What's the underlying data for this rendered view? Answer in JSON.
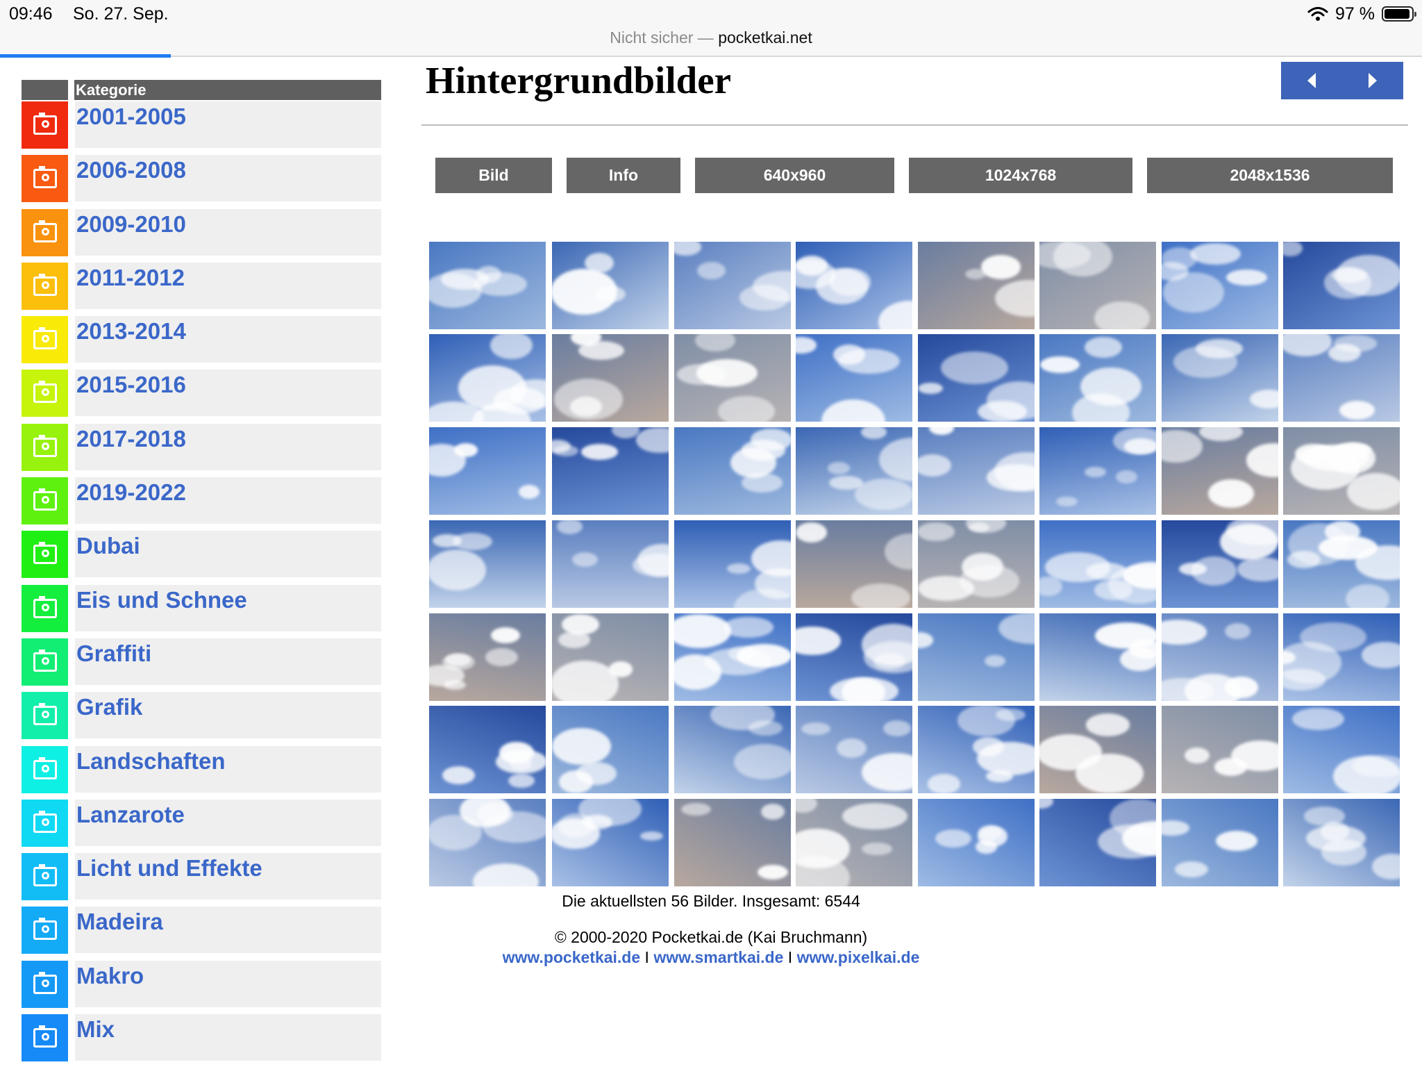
{
  "status_bar": {
    "time": "09:46",
    "date": "So. 27. Sep.",
    "battery": "97 %",
    "battery_level": 0.97
  },
  "url_bar": {
    "insecure_label": "Nicht sicher",
    "separator": " — ",
    "domain": "pocketkai.net",
    "load_progress": 0.12
  },
  "sidebar": {
    "header": "Kategorie",
    "items": [
      {
        "label": "2001-2005",
        "color": "#f02a0f"
      },
      {
        "label": "2006-2008",
        "color": "#f75a10"
      },
      {
        "label": "2009-2010",
        "color": "#f9920e"
      },
      {
        "label": "2011-2012",
        "color": "#fbbf0c"
      },
      {
        "label": "2013-2014",
        "color": "#f9ea07"
      },
      {
        "label": "2015-2016",
        "color": "#c6f40b"
      },
      {
        "label": "2017-2018",
        "color": "#97f30d"
      },
      {
        "label": "2019-2022",
        "color": "#5ef10f"
      },
      {
        "label": "Dubai",
        "color": "#20ef14"
      },
      {
        "label": "Eis und Schnee",
        "color": "#14ee3d"
      },
      {
        "label": "Graffiti",
        "color": "#12ee74"
      },
      {
        "label": "Grafik",
        "color": "#12efaa"
      },
      {
        "label": "Landschaften",
        "color": "#0ff0e4"
      },
      {
        "label": "Lanzarote",
        "color": "#10d9f4"
      },
      {
        "label": "Licht und Effekte",
        "color": "#12bdf6"
      },
      {
        "label": "Madeira",
        "color": "#13aaf6"
      },
      {
        "label": "Makro",
        "color": "#1599f6"
      },
      {
        "label": "Mix",
        "color": "#168af7"
      }
    ]
  },
  "main": {
    "title": "Hintergrundbilder",
    "tabs": [
      "Bild",
      "Info",
      "640x960",
      "1024x768",
      "2048x1536"
    ],
    "footer_count": "Die aktuellsten 56 Bilder. Insgesamt: 6544",
    "copyright": "© 2000-2020 Pocketkai.de (Kai Bruchmann)",
    "links": [
      "www.pocketkai.de",
      "www.smartkai.de",
      "www.pixelkai.de"
    ],
    "link_separator": " I "
  },
  "icons": {
    "wifi": "wifi-icon",
    "battery": "battery-icon",
    "category": "camera-icon",
    "prev": "triangle-left-icon",
    "next": "triangle-right-icon"
  }
}
